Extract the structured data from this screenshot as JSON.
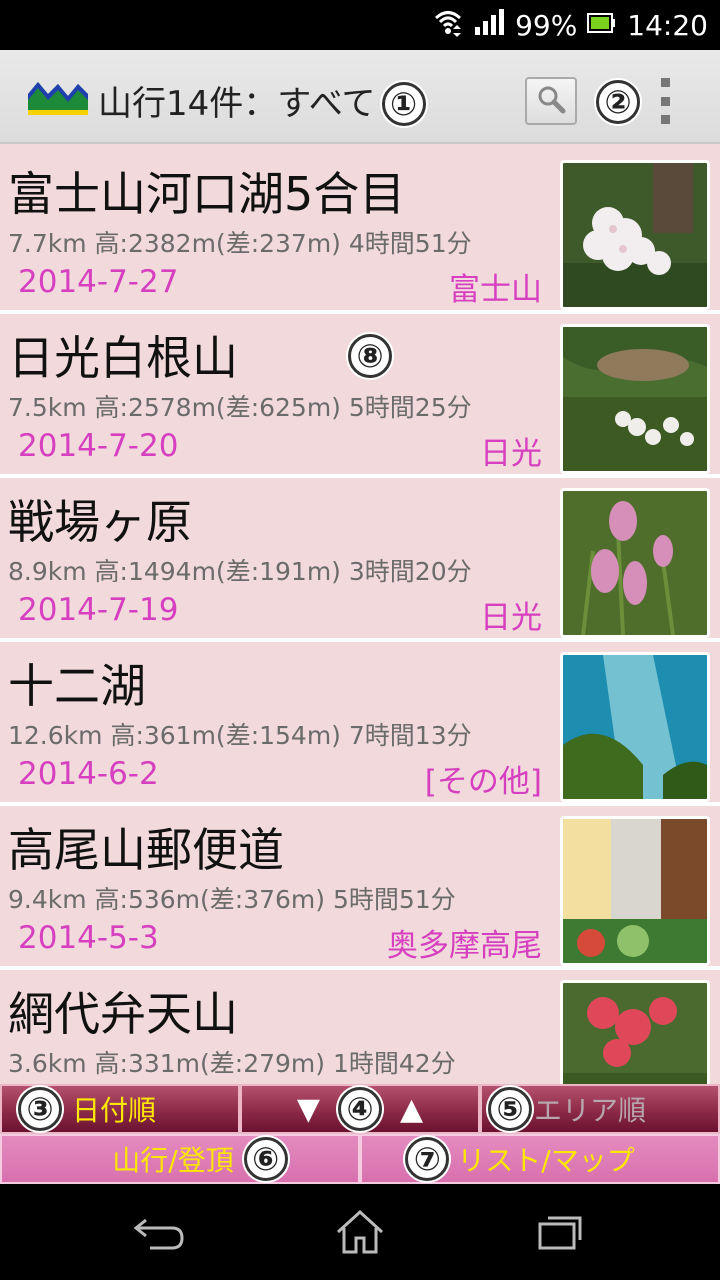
{
  "status": {
    "battery_percent": "99%",
    "time": "14:20"
  },
  "actionbar": {
    "title": "山行14件：すべて",
    "marker_title": "①",
    "marker_menu": "②"
  },
  "list": {
    "marker_item": "⑧",
    "items": [
      {
        "name": "富士山河口湖5合目",
        "stats": "7.7km 高:2382m(差:237m) 4時間51分",
        "date": "2014-7-27",
        "area": "富士山",
        "thumb": "photo-white-rhododendron"
      },
      {
        "name": "日光白根山",
        "stats": "7.5km 高:2578m(差:625m) 5時間25分",
        "date": "2014-7-20",
        "area": "日光",
        "thumb": "photo-mountain-pond"
      },
      {
        "name": "戦場ヶ原",
        "stats": "8.9km 高:1494m(差:191m) 3時間20分",
        "date": "2014-7-19",
        "area": "日光",
        "thumb": "photo-pink-flowers"
      },
      {
        "name": "十二湖",
        "stats": "12.6km 高:361m(差:154m) 7時間13分",
        "date": "2014-6-2",
        "area": "[その他]",
        "thumb": "photo-blue-lake"
      },
      {
        "name": "高尾山郵便道",
        "stats": "9.4km 高:536m(差:376m) 5時間51分",
        "date": "2014-5-3",
        "area": "奥多摩高尾",
        "thumb": "photo-lunch"
      },
      {
        "name": "網代弁天山",
        "stats": "3.6km 高:331m(差:279m) 1時間42分",
        "date": "",
        "area": "",
        "thumb": "photo-azalea"
      }
    ]
  },
  "bottombar": {
    "sort_date": {
      "marker": "③",
      "label": "日付順"
    },
    "sort_dir": {
      "down": "▼",
      "marker": "④",
      "up": "▲"
    },
    "sort_area": {
      "marker": "⑤",
      "label": "エリア順"
    },
    "mode": {
      "label": "山行/登頂",
      "marker": "⑥"
    },
    "view": {
      "marker": "⑦",
      "label": "リスト/マップ"
    }
  },
  "colors": {
    "row_bg": "#f2dadc",
    "accent_pink": "#d63fbf",
    "dark_button": "#8c2a48",
    "pink_button": "#d870ae",
    "yellow_label": "#ffe800"
  }
}
